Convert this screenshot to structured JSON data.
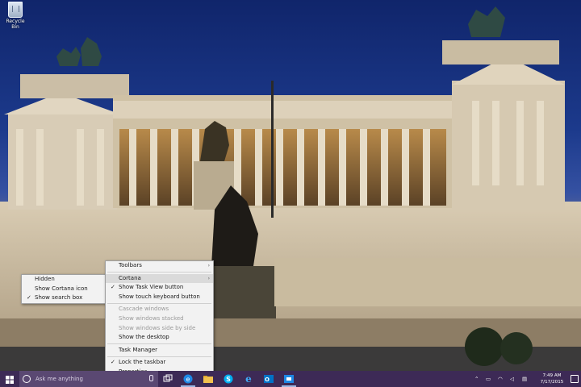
{
  "desktop": {
    "recycle_bin_label": "Recycle Bin"
  },
  "cortana_submenu": {
    "items": [
      {
        "label": "Hidden",
        "checked": false
      },
      {
        "label": "Show Cortana icon",
        "checked": false
      },
      {
        "label": "Show search box",
        "checked": true
      }
    ]
  },
  "context_menu": {
    "toolbars": "Toolbars",
    "cortana": "Cortana",
    "show_task_view": "Show Task View button",
    "show_touch_keyboard": "Show touch keyboard button",
    "cascade": "Cascade windows",
    "stacked": "Show windows stacked",
    "side_by_side": "Show windows side by side",
    "show_desktop": "Show the desktop",
    "task_manager": "Task Manager",
    "lock_taskbar": "Lock the taskbar",
    "properties": "Properties"
  },
  "taskbar": {
    "search_placeholder": "Ask me anything",
    "clock_time": "7:49 AM",
    "clock_date": "7/17/2015",
    "background": "#3d2a56"
  },
  "icons": {
    "start": "windows-logo-icon",
    "task_view": "task-view-icon",
    "edge": "edge-icon",
    "explorer": "file-explorer-icon",
    "skype": "skype-icon",
    "ie": "internet-explorer-icon",
    "outlook": "outlook-icon",
    "store": "store-icon"
  }
}
